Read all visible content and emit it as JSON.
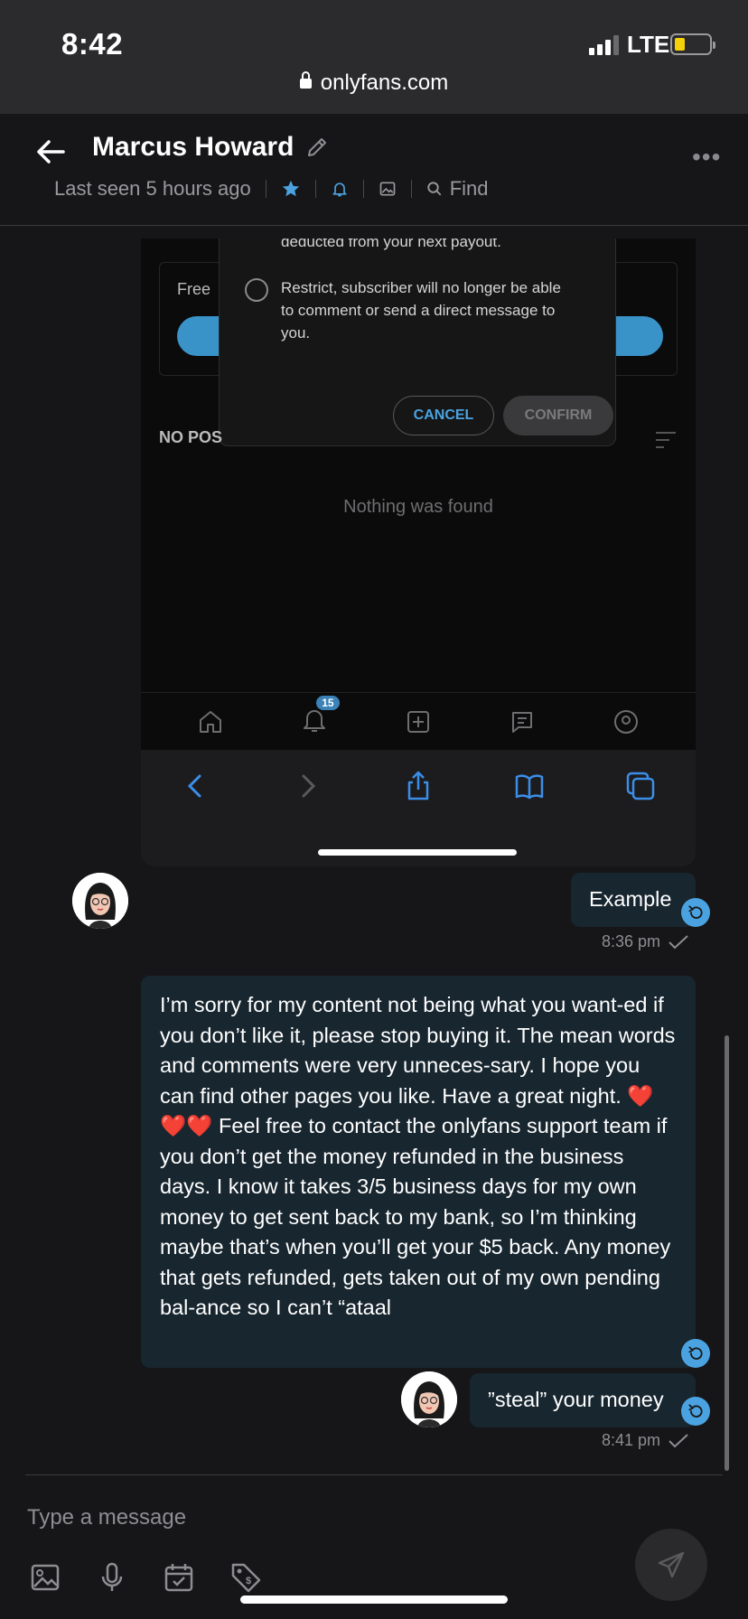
{
  "status_bar": {
    "time": "8:42",
    "network": "LTE",
    "battery_color": "#f5d10b"
  },
  "browser": {
    "url": "onlyfans.com"
  },
  "chat": {
    "contact_name": "Marcus Howard",
    "last_seen": "Last seen 5 hours ago",
    "find_label": "Find"
  },
  "screenshot": {
    "deducted_text": "deducted from your next payout.",
    "restrict_text": "Restrict, subscriber will no longer be able to comment or send a direct message to you.",
    "cancel_label": "CANCEL",
    "confirm_label": "CONFIRM",
    "free_label": "Free",
    "no_posts_label": "NO POS",
    "empty_text": "Nothing was found",
    "notification_count": "15"
  },
  "messages": [
    {
      "text": "Example",
      "time": "8:36 pm"
    },
    {
      "text": "I’m sorry for my content not being what you want-ed if you don’t like it, please stop buying it. The mean words and comments were very unneces-sary. I hope you can find other pages you like. Have a great night. ❤️❤️❤️ Feel free to contact the onlyfans support team if you don’t get the money refunded in the business days. I know it takes 3/5 business days for my own money to get sent back to my bank, so I’m thinking maybe that’s when you’ll get your $5 back. Any money that gets refunded, gets taken out of my own pending bal-ance so I can’t “ataal"
    },
    {
      "text": "”steal” your money",
      "time": "8:41 pm"
    }
  ],
  "composer": {
    "placeholder": "Type a message"
  },
  "colors": {
    "accent": "#4aa3e0",
    "bubble": "#18262f",
    "background": "#161618"
  }
}
